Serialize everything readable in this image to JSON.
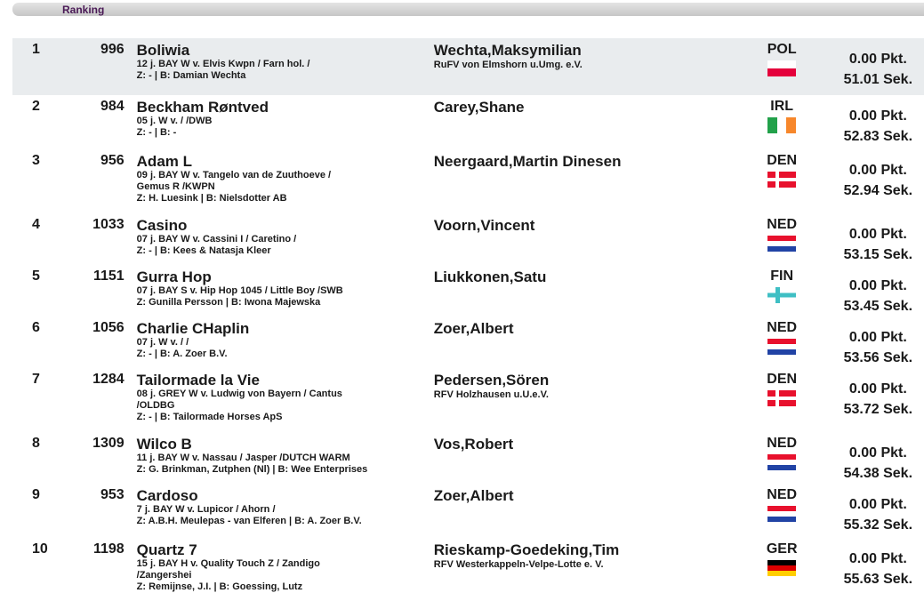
{
  "header": {
    "tab_label": "Ranking"
  },
  "entries": [
    {
      "rank": "1",
      "number": "996",
      "horse": "Boliwia",
      "info": "12 j. BAY W v. Elvis Kwpn / Farn hol. /",
      "info2": "",
      "breeder": "Z: - | B: Damian Wechta",
      "rider": "Wechta,Maksymilian",
      "club": "RuFV von Elmshorn u.Umg. e.V.",
      "nation": "POL",
      "flag": "pol",
      "points": "0.00 Pkt.",
      "time": "51.01 Sek."
    },
    {
      "rank": "2",
      "number": "984",
      "horse": "Beckham Røntved",
      "info": "05 j. W v. / /DWB",
      "info2": "",
      "breeder": "Z: - | B: -",
      "rider": "Carey,Shane",
      "club": "",
      "nation": "IRL",
      "flag": "irl",
      "points": "0.00 Pkt.",
      "time": "52.83 Sek."
    },
    {
      "rank": "3",
      "number": "956",
      "horse": "Adam L",
      "info": "09 j. BAY W v. Tangelo van de Zuuthoeve /",
      "info2": "Gemus R /KWPN",
      "breeder": "Z: H. Luesink | B: Nielsdotter AB",
      "rider": "Neergaard,Martin Dinesen",
      "club": "",
      "nation": "DEN",
      "flag": "den",
      "points": "0.00 Pkt.",
      "time": "52.94 Sek."
    },
    {
      "rank": "4",
      "number": "1033",
      "horse": "Casino",
      "info": "07 j. BAY W v. Cassini I / Caretino /",
      "info2": "",
      "breeder": "Z: - | B: Kees & Natasja Kleer",
      "rider": "Voorn,Vincent",
      "club": "",
      "nation": "NED",
      "flag": "ned",
      "points": "0.00 Pkt.",
      "time": "53.15 Sek."
    },
    {
      "rank": "5",
      "number": "1151",
      "horse": "Gurra Hop",
      "info": "07 j. BAY S v. Hip Hop 1045 / Little Boy /SWB",
      "info2": "",
      "breeder": "Z: Gunilla Persson | B: Iwona Majewska",
      "rider": "Liukkonen,Satu",
      "club": "",
      "nation": "FIN",
      "flag": "fin",
      "points": "0.00 Pkt.",
      "time": "53.45 Sek."
    },
    {
      "rank": "6",
      "number": "1056",
      "horse": "Charlie CHaplin",
      "info": "07 j. W v. / /",
      "info2": "",
      "breeder": "Z: - | B: A. Zoer B.V.",
      "rider": "Zoer,Albert",
      "club": "",
      "nation": "NED",
      "flag": "ned",
      "points": "0.00 Pkt.",
      "time": "53.56 Sek."
    },
    {
      "rank": "7",
      "number": "1284",
      "horse": "Tailormade la Vie",
      "info": "08 j. GREY W v. Ludwig von Bayern / Cantus",
      "info2": "/OLDBG",
      "breeder": "Z: - | B: Tailormade Horses ApS",
      "rider": "Pedersen,Sören",
      "club": "RFV Holzhausen u.U.e.V.",
      "nation": "DEN",
      "flag": "den",
      "points": "0.00 Pkt.",
      "time": "53.72 Sek."
    },
    {
      "rank": "8",
      "number": "1309",
      "horse": "Wilco B",
      "info": "11 j. BAY W v. Nassau / Jasper /DUTCH WARM",
      "info2": "",
      "breeder": "Z: G. Brinkman, Zutphen (Nl) | B: Wee Enterprises",
      "rider": "Vos,Robert",
      "club": "",
      "nation": "NED",
      "flag": "ned",
      "points": "0.00 Pkt.",
      "time": "54.38 Sek."
    },
    {
      "rank": "9",
      "number": "953",
      "horse": "Cardoso",
      "info": "7 j. BAY W v. Lupicor / Ahorn /",
      "info2": "",
      "breeder": "Z: A.B.H. Meulepas - van Elferen | B: A. Zoer B.V.",
      "rider": "Zoer,Albert",
      "club": "",
      "nation": "NED",
      "flag": "ned",
      "points": "0.00 Pkt.",
      "time": "55.32 Sek."
    },
    {
      "rank": "10",
      "number": "1198",
      "horse": "Quartz 7",
      "info": "15 j. BAY H v. Quality Touch Z / Zandigo",
      "info2": "/Zangershei",
      "breeder": "Z: Remijnse, J.I. | B: Goessing, Lutz",
      "rider": "Rieskamp-Goedeking,Tim",
      "club": "RFV Westerkappeln-Velpe-Lotte e. V.",
      "nation": "GER",
      "flag": "ger",
      "points": "0.00 Pkt.",
      "time": "55.63 Sek."
    }
  ]
}
